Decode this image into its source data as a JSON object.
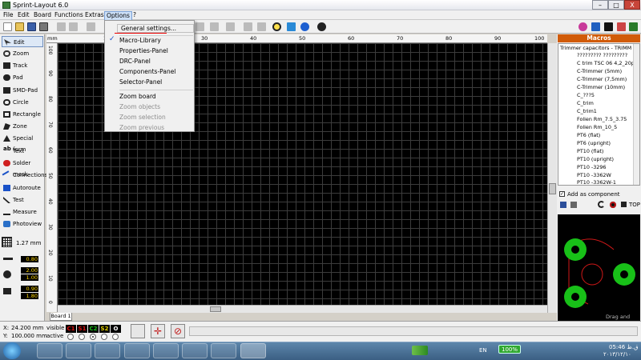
{
  "window": {
    "title": "Sprint-Layout 6.0",
    "close": "X"
  },
  "menubar": [
    "File",
    "Edit",
    "Board",
    "Functions",
    "Extras",
    "Options",
    "?"
  ],
  "options_menu": {
    "items": [
      "General settings...",
      "Macro-Library",
      "Properties-Panel",
      "DRC-Panel",
      "Components-Panel",
      "Selector-Panel"
    ],
    "checked": "Macro-Library",
    "zoom_items": [
      "Zoom board",
      "Zoom objects",
      "Zoom selection",
      "Zoom previous"
    ],
    "disabled": [
      "Zoom objects",
      "Zoom selection",
      "Zoom previous"
    ]
  },
  "tools": [
    "Edit",
    "Zoom",
    "Track",
    "Pad",
    "SMD-Pad",
    "Circle",
    "Rectangle",
    "Zone",
    "Special form",
    "Text",
    "Solder mask",
    "Connections",
    "Autoroute",
    "Test",
    "Measure",
    "Photoview"
  ],
  "grid": "1.27 mm",
  "values": [
    "0.80",
    "2.00",
    "1.00",
    "0.90",
    "1.80"
  ],
  "rulers": {
    "unit": "mm",
    "top": [
      "10",
      "20",
      "30",
      "40",
      "50",
      "60",
      "70",
      "80",
      "90",
      "100"
    ],
    "left": [
      "100",
      "90",
      "80",
      "70",
      "60",
      "50",
      "40",
      "30",
      "20",
      "10",
      "0"
    ]
  },
  "board_tab": "Board 1",
  "macros": {
    "title": "Macros",
    "tree_root": "Trimmer capacitors - TRIMM",
    "items": [
      "????????? ?????????",
      "C trim TSC 06 4,2_20pF",
      "C-Trimmer (5mm)",
      "C-Trimmer (7,5mm)",
      "C-Trimmer (10mm)",
      "C_???5",
      "C_trim",
      "C_trim1",
      "Folien Rm_7.5_3.75",
      "Folien Rm_10_5",
      "PT6 (flat)",
      "PT6 (upright)",
      "PT10 (flat)",
      "PT10 (upright)",
      "PT10 -3296",
      "PT10 -3362W",
      "PT10 -3362W-1"
    ],
    "add_as_component": "Add as component",
    "top_label": "TOP",
    "drag_hint": "Drag and Drop"
  },
  "status": {
    "x_label": "X:",
    "x_value": "24.200 mm",
    "y_label": "Y:",
    "y_value": "100.000 mm",
    "visible": "visible",
    "active": "active",
    "layers": [
      {
        "name": "C1",
        "color": "#e01010"
      },
      {
        "name": "S1",
        "color": "#e01010"
      },
      {
        "name": "C2",
        "color": "#18c018"
      },
      {
        "name": "S2",
        "color": "#e6d400"
      },
      {
        "name": "O",
        "color": "#ffffff"
      }
    ]
  },
  "tray": {
    "lang": "EN",
    "battery": "100%",
    "time": "05:46 ق.ظ",
    "date": "۲۰۱۳/۱۲/۱۰"
  }
}
